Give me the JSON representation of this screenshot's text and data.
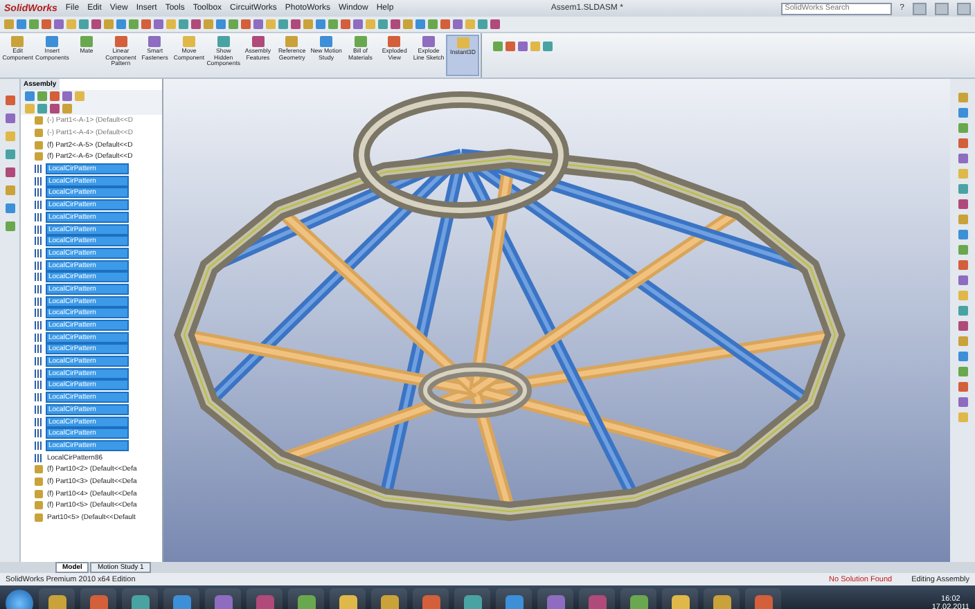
{
  "menu_bar": {
    "logo": "SolidWorks",
    "items": [
      "File",
      "Edit",
      "View",
      "Insert",
      "Tools",
      "Toolbox",
      "CircuitWorks",
      "PhotoWorks",
      "Window",
      "Help"
    ],
    "title": "Assem1.SLDASM *",
    "search": {
      "placeholder": "SolidWorks Search"
    },
    "help": "?"
  },
  "command_manager": {
    "buttons": [
      {
        "label": "Edit Component",
        "selected": false
      },
      {
        "label": "Insert Components",
        "selected": false
      },
      {
        "label": "Mate",
        "selected": false
      },
      {
        "label": "Linear Component Pattern",
        "selected": false
      },
      {
        "label": "Smart Fasteners",
        "selected": false
      },
      {
        "label": "Move Component",
        "selected": false
      },
      {
        "label": "Show Hidden Components",
        "selected": false
      },
      {
        "label": "Assembly Features",
        "selected": false
      },
      {
        "label": "Reference Geometry",
        "selected": false
      },
      {
        "label": "New Motion Study",
        "selected": false
      },
      {
        "label": "Bill of Materials",
        "selected": false
      },
      {
        "label": "Exploded View",
        "selected": false
      },
      {
        "label": "Explode Line Sketch",
        "selected": false
      },
      {
        "label": "Instant3D",
        "selected": true
      }
    ]
  },
  "feature_tree": {
    "tab": "Assembly",
    "items": [
      {
        "label": "(-) Part1<-A-1> (Default<<D",
        "kind": "part_warning",
        "selected": false
      },
      {
        "label": "(-) Part1<-A-4> (Default<<D",
        "kind": "part_warning",
        "selected": false
      },
      {
        "label": "(f) Part2<-A-5> (Default<<D",
        "kind": "part",
        "selected": false
      },
      {
        "label": "(f) Part2<-A-6> (Default<<D",
        "kind": "part",
        "selected": false
      },
      {
        "label": "LocalCirPattern",
        "kind": "pattern",
        "selected": true
      },
      {
        "label": "LocalCirPattern",
        "kind": "pattern",
        "selected": true
      },
      {
        "label": "LocalCirPattern",
        "kind": "pattern",
        "selected": true
      },
      {
        "label": "LocalCirPattern",
        "kind": "pattern",
        "selected": true
      },
      {
        "label": "LocalCirPattern",
        "kind": "pattern",
        "selected": true
      },
      {
        "label": "LocalCirPattern",
        "kind": "pattern",
        "selected": true
      },
      {
        "label": "LocalCirPattern",
        "kind": "pattern",
        "selected": true
      },
      {
        "label": "LocalCirPattern",
        "kind": "pattern",
        "selected": true
      },
      {
        "label": "LocalCirPattern",
        "kind": "pattern",
        "selected": true
      },
      {
        "label": "LocalCirPattern",
        "kind": "pattern",
        "selected": true
      },
      {
        "label": "LocalCirPattern",
        "kind": "pattern",
        "selected": true
      },
      {
        "label": "LocalCirPattern",
        "kind": "pattern",
        "selected": true
      },
      {
        "label": "LocalCirPattern",
        "kind": "pattern",
        "selected": true
      },
      {
        "label": "LocalCirPattern",
        "kind": "pattern",
        "selected": true
      },
      {
        "label": "LocalCirPattern",
        "kind": "pattern",
        "selected": true
      },
      {
        "label": "LocalCirPattern",
        "kind": "pattern",
        "selected": true
      },
      {
        "label": "LocalCirPattern",
        "kind": "pattern",
        "selected": true
      },
      {
        "label": "LocalCirPattern",
        "kind": "pattern",
        "selected": true
      },
      {
        "label": "LocalCirPattern",
        "kind": "pattern",
        "selected": true
      },
      {
        "label": "LocalCirPattern",
        "kind": "pattern",
        "selected": true
      },
      {
        "label": "LocalCirPattern",
        "kind": "pattern",
        "selected": true
      },
      {
        "label": "LocalCirPattern",
        "kind": "pattern",
        "selected": true
      },
      {
        "label": "LocalCirPattern",
        "kind": "pattern",
        "selected": true
      },
      {
        "label": "LocalCirPattern",
        "kind": "pattern",
        "selected": true
      },
      {
        "label": "LocalCirPattern86",
        "kind": "pattern",
        "selected": false
      },
      {
        "label": "(f) Part10<2> (Default<<Defa",
        "kind": "part",
        "selected": false
      },
      {
        "label": "(f) Part10<3> (Default<<Defa",
        "kind": "part",
        "selected": false
      },
      {
        "label": "(f) Part10<4> (Default<<Defa",
        "kind": "part",
        "selected": false
      },
      {
        "label": "(f) Part10<5> (Default<<Defa",
        "kind": "part",
        "selected": false
      },
      {
        "label": "Part10<5> (Default<<Default",
        "kind": "part",
        "selected": false
      }
    ]
  },
  "bottom_tabs": [
    {
      "label": "Model",
      "selected": true
    },
    {
      "label": "Motion Study 1",
      "selected": false
    }
  ],
  "status_bar": {
    "edition": "SolidWorks Premium 2010 x64 Edition",
    "warning": "No Solution Found",
    "mode": "Editing Assembly"
  },
  "taskbar": {
    "time": "16:02",
    "date": "17.02.2011"
  }
}
